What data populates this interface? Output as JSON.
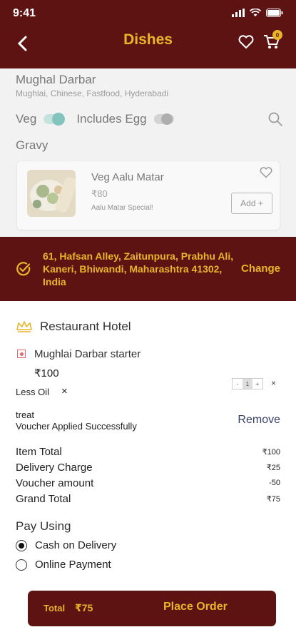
{
  "status_bar": {
    "time": "9:41"
  },
  "header": {
    "title": "Dishes",
    "cart_count": "0"
  },
  "restaurant": {
    "name": "Mughal Darbar",
    "cuisines": "Mughlai, Chinese, Fastfood, Hyderabadi"
  },
  "filters": {
    "veg_label": "Veg",
    "veg_on": true,
    "egg_label": "Includes Egg",
    "egg_on": false
  },
  "menu": {
    "section": "Gravy",
    "dish": {
      "name": "Veg Aalu Matar",
      "price": "₹80",
      "description": "Aalu Matar Special!",
      "add_label": "Add +"
    }
  },
  "address": {
    "text": "61, Hafsan Alley, Zaitunpura, Prabhu Ali, Kaneri, Bhiwandi, Maharashtra 41302, India",
    "change_label": "Change"
  },
  "cart": {
    "restaurant": "Restaurant Hotel",
    "item": {
      "name": "Mughlai Darbar starter",
      "price": "₹100",
      "qty": "1",
      "minus": "-",
      "plus": "+"
    },
    "note": "Less Oil",
    "voucher": {
      "code": "treat",
      "status": "Voucher Applied Successfully",
      "remove_label": "Remove"
    },
    "bill": [
      {
        "label": "Item Total",
        "value": "₹100"
      },
      {
        "label": "Delivery Charge",
        "value": "₹25"
      },
      {
        "label": "Voucher amount",
        "value": "-50"
      },
      {
        "label": "Grand Total",
        "value": "₹75"
      }
    ]
  },
  "payment": {
    "title": "Pay Using",
    "options": [
      {
        "label": "Cash on Delivery",
        "selected": true
      },
      {
        "label": "Online Payment",
        "selected": false
      }
    ]
  },
  "order": {
    "total_label": "Total",
    "total_value": "₹75",
    "button_label": "Place Order"
  },
  "colors": {
    "primary": "#5e1313",
    "accent": "#e8b52a",
    "toggle_on": "#2aa194"
  }
}
